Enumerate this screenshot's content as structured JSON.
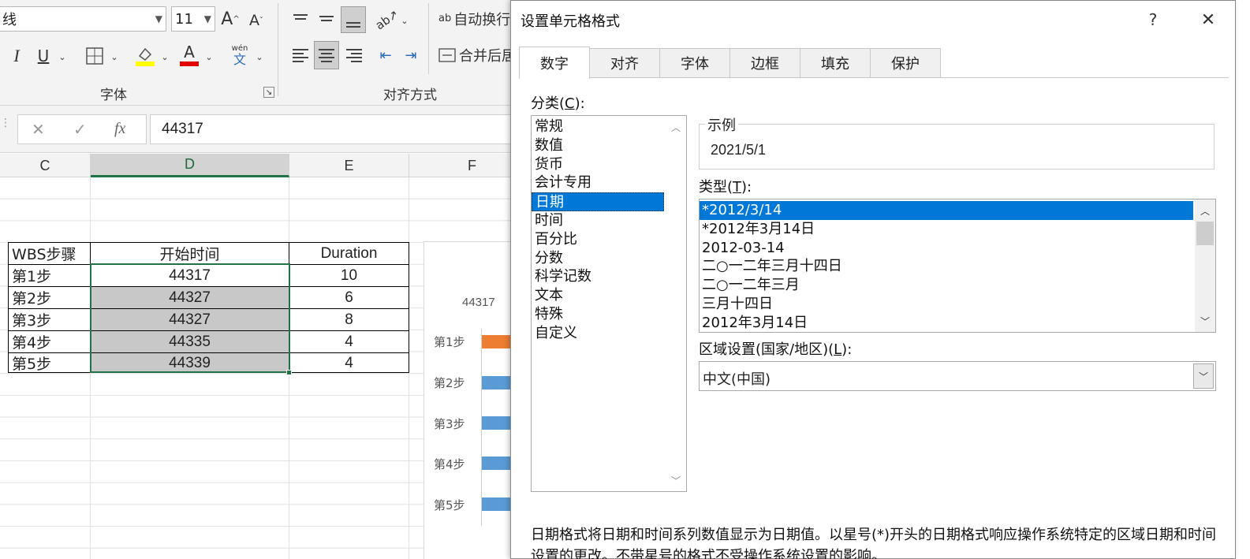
{
  "ribbon": {
    "font_name_partial": "线",
    "font_size": "11",
    "grow_font": "A",
    "shrink_font": "A",
    "italic": "I",
    "underline": "U",
    "phonetic_top": "wén",
    "phonetic_bottom": "文",
    "wrap_text_icon": "ab",
    "wrap_text": "自动换行",
    "merge_center": "合并后居",
    "group_font": "字体",
    "group_align": "对齐方式",
    "colors": {
      "highlight": "#ffff00",
      "font_color": "#e00000"
    }
  },
  "formula_bar": {
    "cancel_icon": "✕",
    "enter_icon": "✓",
    "fx_icon": "fx",
    "value": "44317"
  },
  "grid": {
    "columns": [
      "C",
      "D",
      "E",
      "F"
    ],
    "selected_column": "D",
    "table_header": [
      "WBS步骤",
      "开始时间",
      "Duration"
    ],
    "rows": [
      [
        "第1步",
        "44317",
        "10"
      ],
      [
        "第2步",
        "44327",
        "6"
      ],
      [
        "第3步",
        "44327",
        "8"
      ],
      [
        "第4步",
        "44335",
        "4"
      ],
      [
        "第5步",
        "44339",
        "4"
      ]
    ]
  },
  "chart": {
    "axis_label": "44317",
    "categories": [
      "第1步",
      "第2步",
      "第3步",
      "第4步",
      "第5步"
    ],
    "colors": {
      "first": "#ed7d31",
      "rest": "#5b9bd5"
    }
  },
  "dialog": {
    "title": "设置单元格格式",
    "help_icon": "?",
    "close_icon": "✕",
    "tabs": [
      "数字",
      "对齐",
      "字体",
      "边框",
      "填充",
      "保护"
    ],
    "active_tab": "数字",
    "category_label": "分类(",
    "category_key": "C",
    "category_suffix": "):",
    "categories": [
      "常规",
      "数值",
      "货币",
      "会计专用",
      "日期",
      "时间",
      "百分比",
      "分数",
      "科学记数",
      "文本",
      "特殊",
      "自定义"
    ],
    "selected_category": "日期",
    "sample_label": "示例",
    "sample_value": "2021/5/1",
    "type_label": "类型(",
    "type_key": "T",
    "type_suffix": "):",
    "types": [
      "*2012/3/14",
      "*2012年3月14日",
      "2012-03-14",
      "二○一二年三月十四日",
      "二○一二年三月",
      "三月十四日",
      "2012年3月14日"
    ],
    "selected_type": "*2012/3/14",
    "locale_label": "区域设置(国家/地区)(",
    "locale_key": "L",
    "locale_suffix": "):",
    "locale_value": "中文(中国)",
    "description_line1": "日期格式将日期和时间系列数值显示为日期值。以星号(*)开头的日期格式响应操作系统特定的区域日期和时间",
    "description_line2": "设置的更改。不带星号的格式不受操作系统设置的影响。",
    "colors": {
      "selection": "#0078d7"
    }
  }
}
